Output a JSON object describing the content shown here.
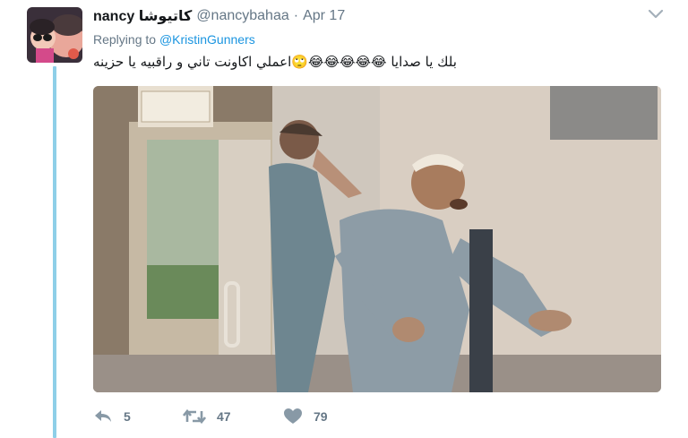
{
  "tweet": {
    "display_name": "nancy كاتيوشا",
    "handle": "@nancybahaa",
    "separator": "·",
    "date": "Apr 17",
    "replying_prefix": "Replying to",
    "replying_to": "@KristinGunners",
    "text": "بلك يا صدايا 😂😂😂😂😂🙄اعملي اكاونت تاني و راقبيه يا حزينه",
    "reply_count": "5",
    "retweet_count": "47",
    "like_count": "79"
  },
  "icons": {
    "caret": "chevron-down-icon",
    "reply": "reply-icon",
    "retweet": "retweet-icon",
    "like": "heart-icon"
  },
  "colors": {
    "link": "#1b95e0",
    "thread_line": "#8ecfe8",
    "muted": "#657786",
    "text": "#14171a"
  }
}
